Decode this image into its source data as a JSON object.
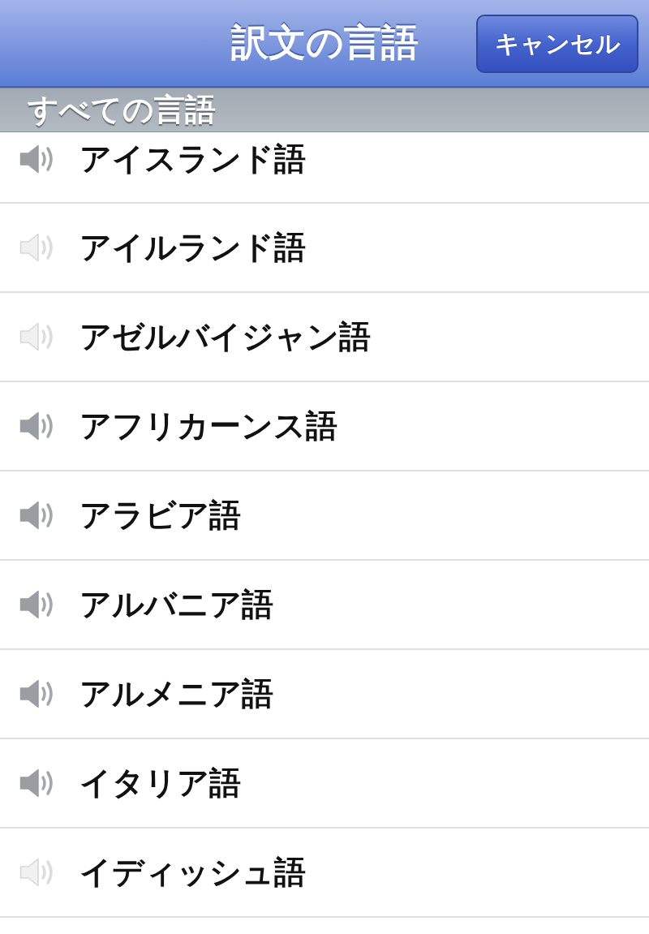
{
  "nav_bar": {
    "title": "訳文の言語",
    "cancel_button": "キャンセル"
  },
  "section": {
    "header": "すべての言語"
  },
  "languages": [
    {
      "name": "アイスランド語",
      "audio_available": true
    },
    {
      "name": "アイルランド語",
      "audio_available": false
    },
    {
      "name": "アゼルバイジャン語",
      "audio_available": false
    },
    {
      "name": "アフリカーンス語",
      "audio_available": true
    },
    {
      "name": "アラビア語",
      "audio_available": true
    },
    {
      "name": "アルバニア語",
      "audio_available": true
    },
    {
      "name": "アルメニア語",
      "audio_available": true
    },
    {
      "name": "イタリア語",
      "audio_available": true
    },
    {
      "name": "イディッシュ語",
      "audio_available": false
    }
  ]
}
